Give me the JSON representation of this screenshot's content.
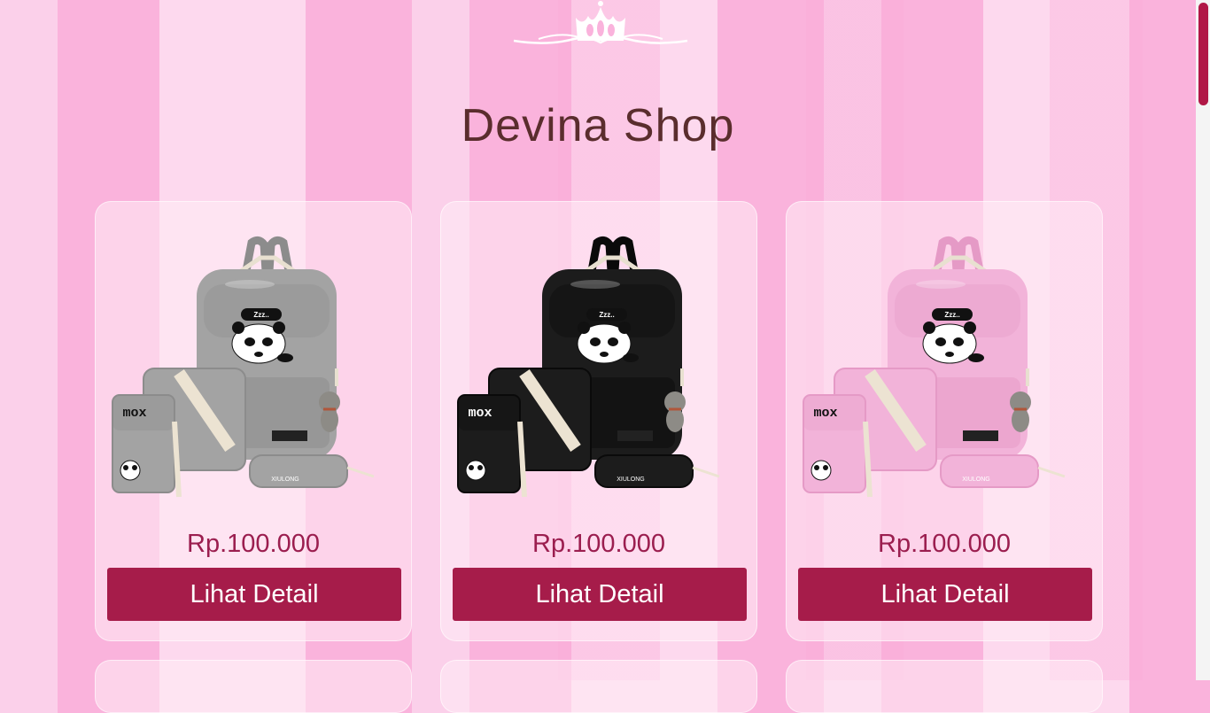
{
  "shop": {
    "title": "Devina Shop"
  },
  "products": [
    {
      "price": "Rp.100.000",
      "button_label": "Lihat Detail",
      "color": "#a3a3a3",
      "dark": "#8c8c8c",
      "text_color": "#111111"
    },
    {
      "price": "Rp.100.000",
      "button_label": "Lihat Detail",
      "color": "#1c1c1c",
      "dark": "#0a0a0a",
      "text_color": "#ffffff"
    },
    {
      "price": "Rp.100.000",
      "button_label": "Lihat Detail",
      "color": "#f2b3d9",
      "dark": "#e59ac6",
      "text_color": "#111111"
    }
  ],
  "product_labels": {
    "pouch_brand": "mox",
    "case_brand": "XIULONG",
    "bubble": "Zzz.."
  },
  "colors": {
    "accent": "#a61c4a",
    "price": "#9b1e4f",
    "title": "#5a2d2d"
  }
}
